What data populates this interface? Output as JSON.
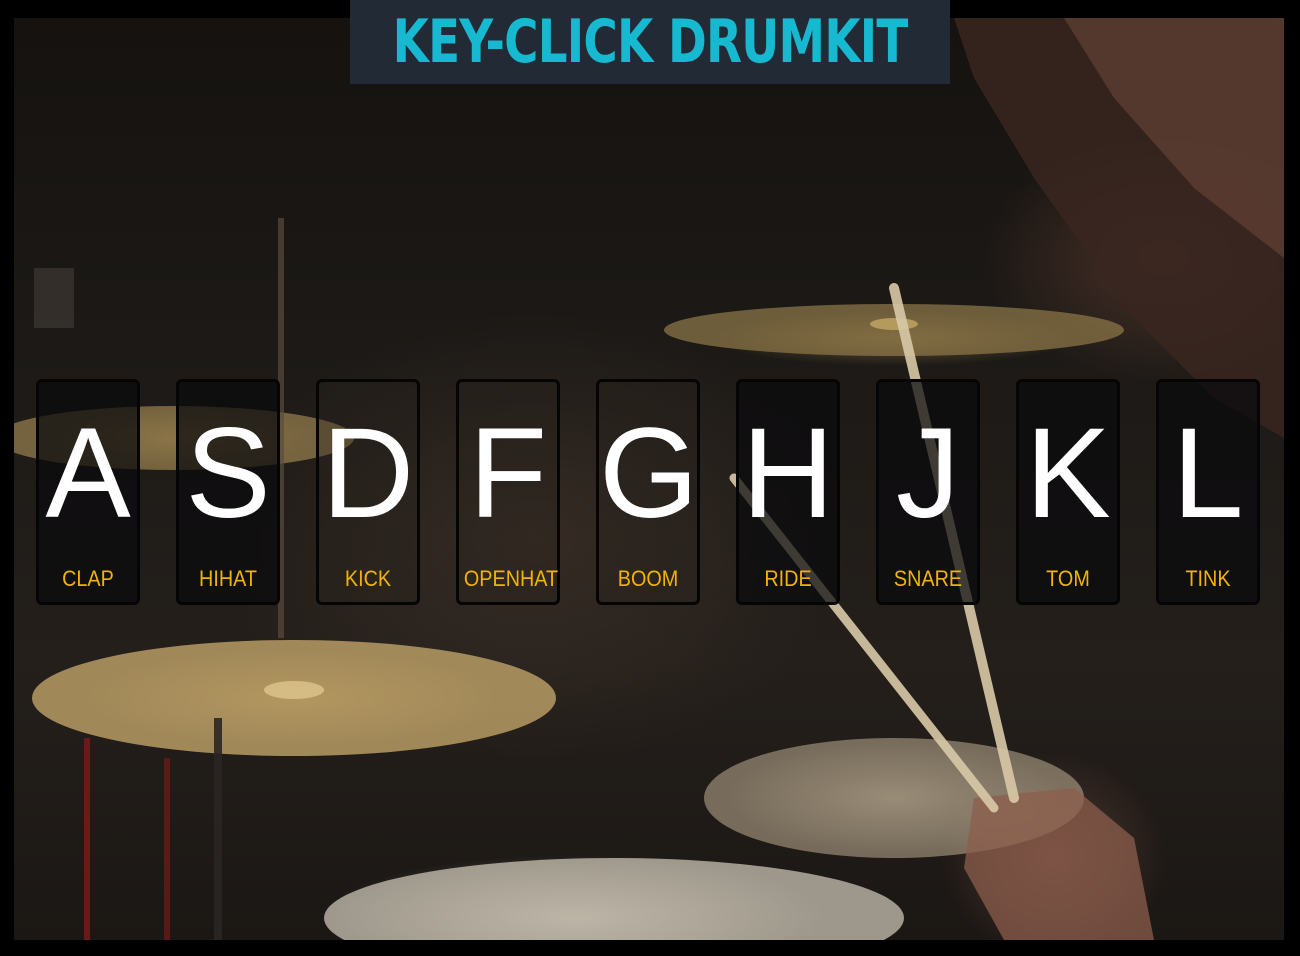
{
  "header": {
    "title": "KEY-CLICK DRUMKIT"
  },
  "keys": [
    {
      "key": "A",
      "sound": "CLAP"
    },
    {
      "key": "S",
      "sound": "HIHAT"
    },
    {
      "key": "D",
      "sound": "KICK"
    },
    {
      "key": "F",
      "sound": "OPENHAT"
    },
    {
      "key": "G",
      "sound": "BOOM"
    },
    {
      "key": "H",
      "sound": "RIDE"
    },
    {
      "key": "J",
      "sound": "SNARE"
    },
    {
      "key": "K",
      "sound": "TOM"
    },
    {
      "key": "L",
      "sound": "TINK"
    }
  ],
  "colors": {
    "title": "#17b9d1",
    "title_bar": "#222a36",
    "key_letter": "#ffffff",
    "sound_label": "#f0b400"
  },
  "background": {
    "image": "drum-kit-photo"
  }
}
